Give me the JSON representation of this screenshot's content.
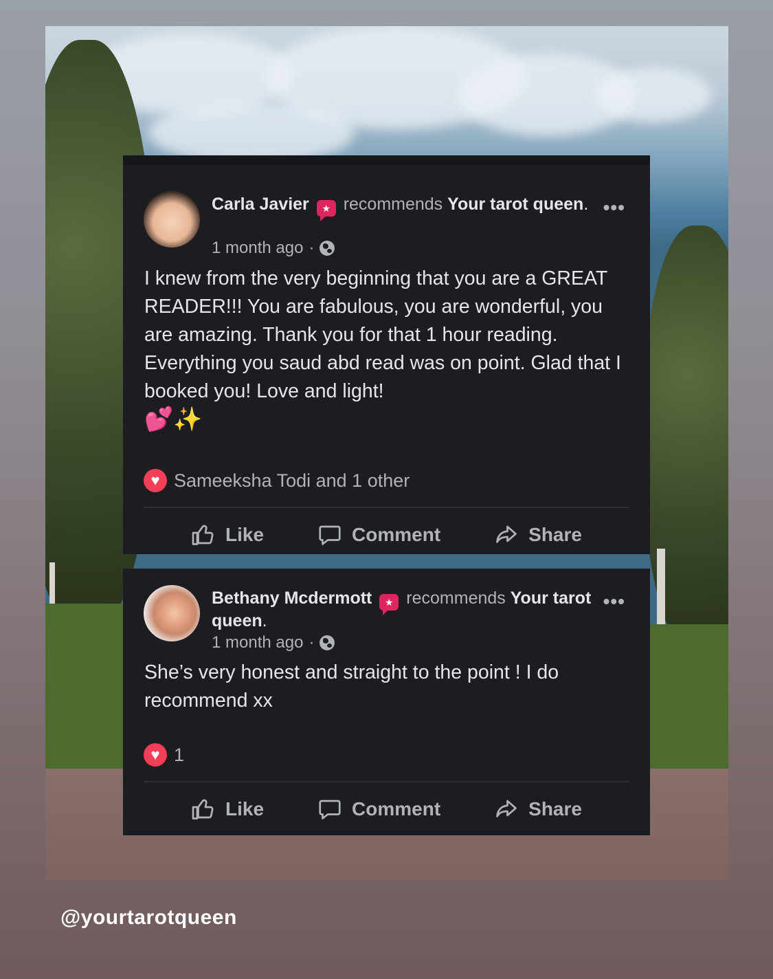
{
  "posts": [
    {
      "author": "Carla Javier",
      "recommends": "recommends",
      "page": "Your tarot queen",
      "period": ".",
      "time": "1 month ago",
      "separator": "·",
      "text": "I knew from the very beginning that you are a GREAT READER!!! You are fabulous, you are wonderful, you are amazing. Thank you for that 1 hour reading. Everything you saud abd read was on point. Glad that I booked you! Love and light!",
      "emoji_heart": "💕",
      "emoji_sparkle": "✨",
      "reactions": "Sameeksha Todi and 1 other"
    },
    {
      "author": "Bethany Mcdermott",
      "recommends": "recommends",
      "page": "Your tarot queen",
      "period": ".",
      "time": "1 month ago",
      "separator": "·",
      "text": "She’s very honest and straight to the point ! I do recommend xx",
      "reactions": "1"
    }
  ],
  "actions": {
    "like": "Like",
    "comment": "Comment",
    "share": "Share"
  },
  "more": "•••",
  "badge": "★",
  "handle": "@yourtarotqueen",
  "colors": {
    "card": "#1c1d20",
    "text": "#e4e6eb",
    "muted": "#b0b3b8",
    "heart": "#f33e58",
    "badge": "#e0245e"
  }
}
